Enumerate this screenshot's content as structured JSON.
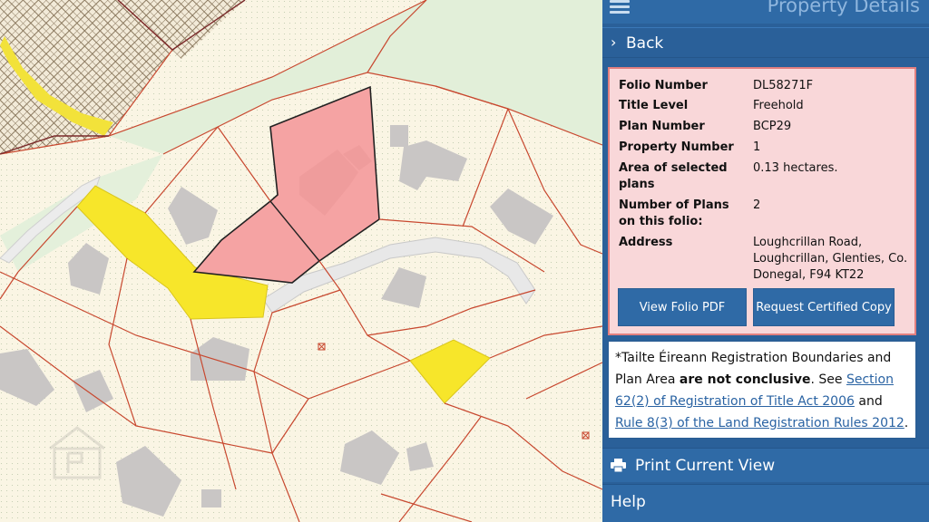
{
  "panel": {
    "title": "Property Details",
    "back_label": "Back"
  },
  "details": [
    {
      "key": "Folio Number",
      "value": "DL58271F"
    },
    {
      "key": "Title Level",
      "value": "Freehold"
    },
    {
      "key": "Plan Number",
      "value": "BCP29"
    },
    {
      "key": "Property Number",
      "value": "1"
    },
    {
      "key": "Area of selected plans",
      "value": "0.13 hectares."
    },
    {
      "key": "Number of Plans on this folio:",
      "value": "2"
    },
    {
      "key": "Address",
      "value": "Loughcrillan Road, Loughcrillan, Glenties, Co. Donegal, F94 KT22"
    }
  ],
  "buttons": {
    "view_pdf": "View Folio PDF",
    "request_copy": "Request Certified Copy"
  },
  "notice": {
    "prefix": "*Tailte Éireann Registration Boundaries and Plan Area ",
    "bold": "are not conclusive",
    "mid": ". See ",
    "link1": "Section 62(2) of Registration of Title Act 2006",
    "and": " and ",
    "link2": "Rule 8(3) of the Land Registration Rules 2012",
    "end": "."
  },
  "menu": {
    "print": "Print Current View",
    "help": "Help"
  },
  "icons": {
    "menu": "hamburger-icon",
    "back": "chevron-left-icon",
    "print": "printer-icon"
  },
  "colors": {
    "panel": "#2a6099",
    "selected_plot": "#f5a3a3",
    "highlight_plot": "#f7e62a",
    "boundary": "#c8482f"
  }
}
